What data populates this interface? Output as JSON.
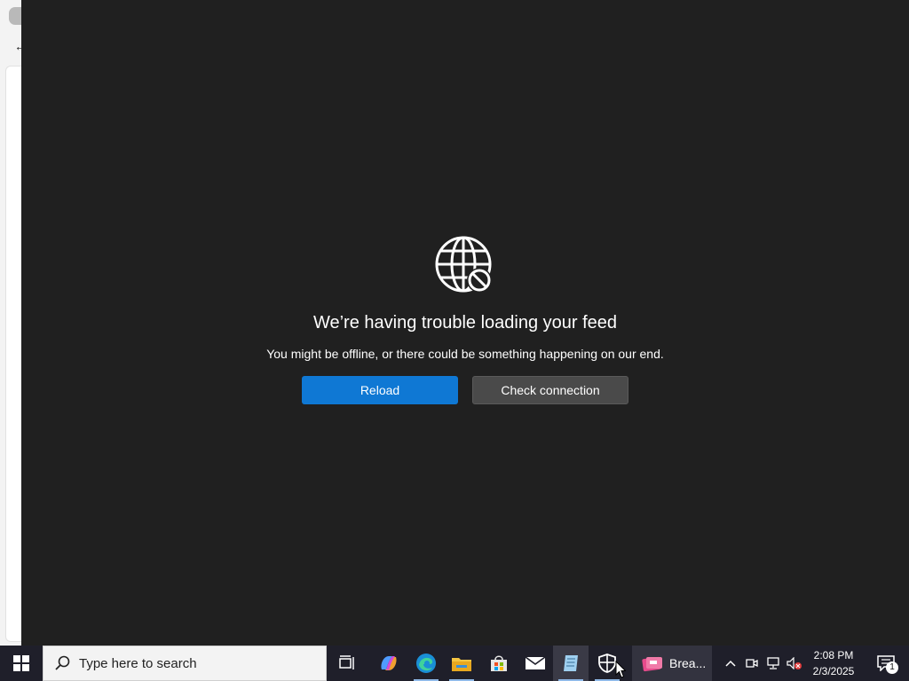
{
  "feed": {
    "error_title": "We’re having trouble loading your feed",
    "error_message": "You might be offline, or there could be something happening on our end.",
    "reload_label": "Reload",
    "check_connection_label": "Check connection",
    "icon": "globe-blocked-icon"
  },
  "taskbar": {
    "search_placeholder": "Type here to search",
    "apps": [
      {
        "name": "task-view-icon"
      },
      {
        "name": "copilot-icon"
      },
      {
        "name": "edge-icon"
      },
      {
        "name": "file-explorer-icon"
      },
      {
        "name": "microsoft-store-icon"
      },
      {
        "name": "mail-icon"
      },
      {
        "name": "notepad-icon"
      },
      {
        "name": "security-icon"
      }
    ],
    "running_app_label": "Brea...",
    "clock": {
      "time": "2:08 PM",
      "date": "2/3/2025"
    },
    "notification_count": "1"
  },
  "colors": {
    "accent": "#0f78d4",
    "panel_bg": "#202020",
    "taskbar_bg": "#1f1f2a"
  }
}
